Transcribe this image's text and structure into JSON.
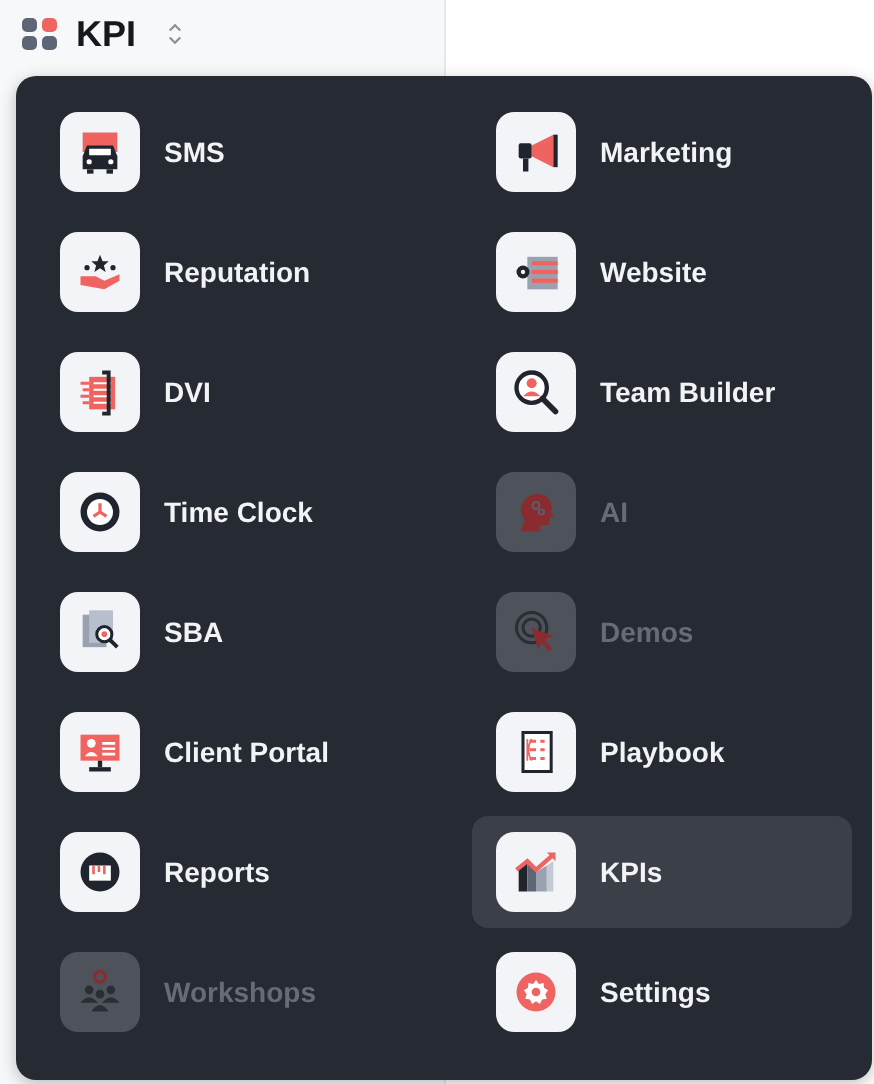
{
  "header": {
    "title": "KPI"
  },
  "menu": {
    "items": [
      {
        "label": "SMS",
        "kind": "truck",
        "disabled": false,
        "selected": false
      },
      {
        "label": "Marketing",
        "kind": "megaphone",
        "disabled": false,
        "selected": false
      },
      {
        "label": "Reputation",
        "kind": "stars-hand",
        "disabled": false,
        "selected": false
      },
      {
        "label": "Website",
        "kind": "webpage",
        "disabled": false,
        "selected": false
      },
      {
        "label": "DVI",
        "kind": "clipboard",
        "disabled": false,
        "selected": false
      },
      {
        "label": "Team Builder",
        "kind": "magnifier-person",
        "disabled": false,
        "selected": false
      },
      {
        "label": "Time Clock",
        "kind": "clock",
        "disabled": false,
        "selected": false
      },
      {
        "label": "AI",
        "kind": "head",
        "disabled": true,
        "selected": false
      },
      {
        "label": "SBA",
        "kind": "document-search",
        "disabled": false,
        "selected": false
      },
      {
        "label": "Demos",
        "kind": "cursor",
        "disabled": true,
        "selected": false
      },
      {
        "label": "Client Portal",
        "kind": "monitor",
        "disabled": false,
        "selected": false
      },
      {
        "label": "Playbook",
        "kind": "checklist",
        "disabled": false,
        "selected": false
      },
      {
        "label": "Reports",
        "kind": "report",
        "disabled": false,
        "selected": false
      },
      {
        "label": "KPIs",
        "kind": "chart",
        "disabled": false,
        "selected": true
      },
      {
        "label": "Workshops",
        "kind": "people",
        "disabled": true,
        "selected": false
      },
      {
        "label": "Settings",
        "kind": "gear",
        "disabled": false,
        "selected": false
      }
    ]
  }
}
